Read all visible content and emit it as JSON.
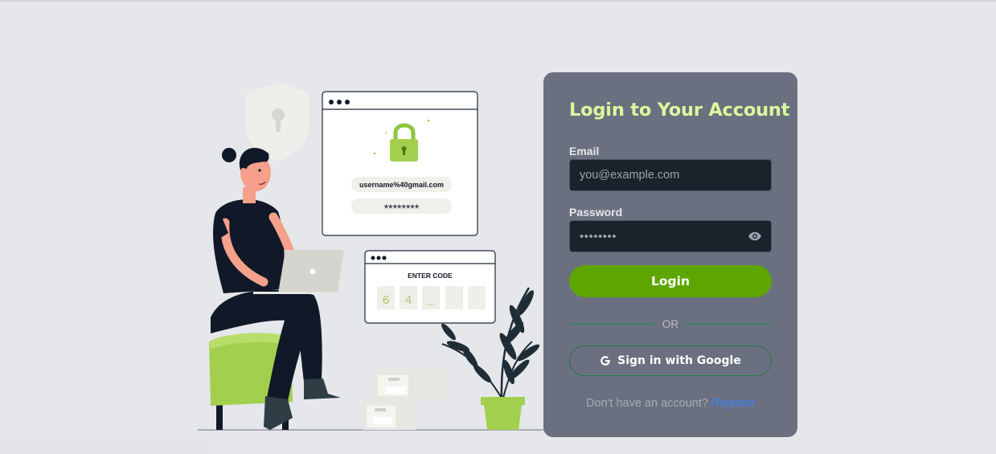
{
  "illustration": {
    "username_text": "username%40gmail.com",
    "password_text": "********",
    "enter_code_text": "ENTER CODE",
    "code_digits": [
      "6",
      "4",
      "_",
      "",
      ""
    ]
  },
  "login": {
    "title": "Login to Your Account",
    "email_label": "Email",
    "email_placeholder": "you@example.com",
    "password_label": "Password",
    "password_mask": "••••••••",
    "login_button": "Login",
    "or_text": "OR",
    "google_button": "Sign in with Google",
    "no_account_text": "Don't have an account?",
    "register_link": "Register"
  },
  "colors": {
    "page_background": "#e5e7eb",
    "card_background": "#6b7080",
    "title_color": "#d9f99d",
    "login_button": "#5ea500",
    "input_background": "#1c222c",
    "link": "#3b82f6"
  },
  "icons": {
    "password_toggle": "eye-icon",
    "google": "google-icon"
  }
}
